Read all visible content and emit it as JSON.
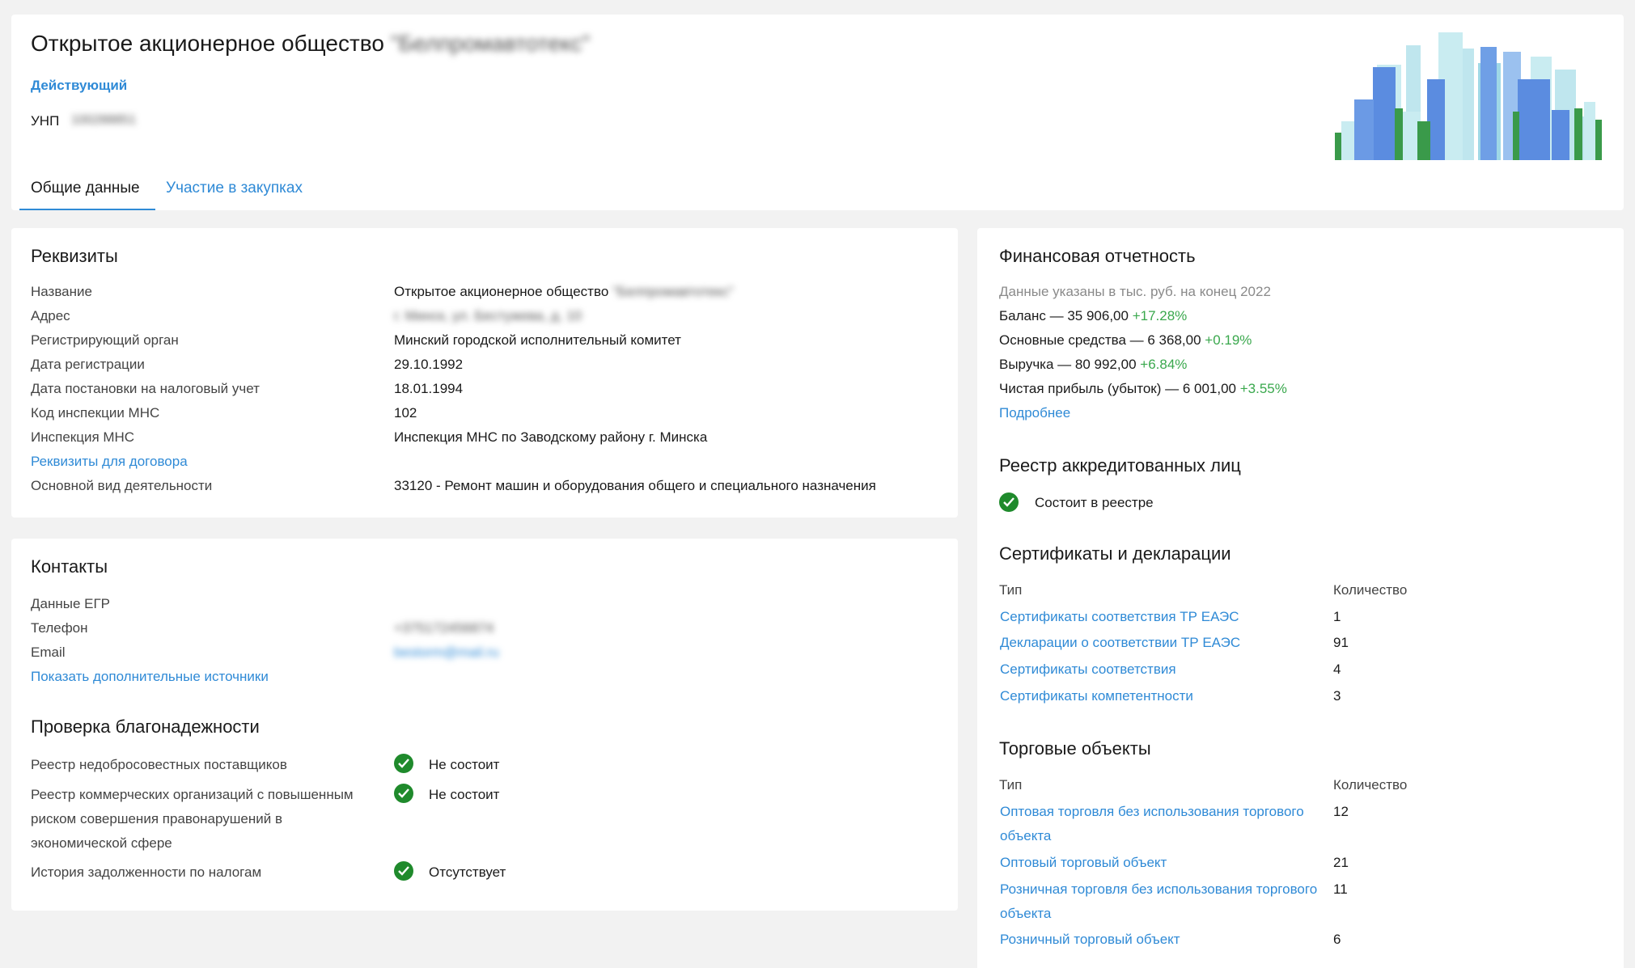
{
  "header": {
    "company_title_prefix": "Открытое акционерное общество",
    "company_title_name": "\"Белпромавтотекс\"",
    "status": "Действующий",
    "unp_label": "УНП",
    "unp_value": "100288851",
    "tabs": [
      {
        "label": "Общие данные",
        "active": true
      },
      {
        "label": "Участие в закупках",
        "active": false
      }
    ]
  },
  "requisites": {
    "title": "Реквизиты",
    "rows": [
      {
        "label": "Название",
        "value": "Открытое акционерное общество",
        "value_blurred": "\"Белпромавтотекс\""
      },
      {
        "label": "Адрес",
        "value": "",
        "value_blurred": "г. Минск, ул. Бестужева, д. 10"
      },
      {
        "label": "Регистрирующий орган",
        "value": "Минский городской исполнительный комитет"
      },
      {
        "label": "Дата регистрации",
        "value": "29.10.1992"
      },
      {
        "label": "Дата постановки на налоговый учет",
        "value": "18.01.1994"
      },
      {
        "label": "Код инспекции МНС",
        "value": "102"
      },
      {
        "label": "Инспекция МНС",
        "value": "Инспекция МНС по Заводскому району г. Минска"
      },
      {
        "label": "Реквизиты для договора",
        "value": ""
      },
      {
        "label": "Основной вид деятельности",
        "value": "33120 - Ремонт машин и оборудования общего и специального назначения"
      }
    ]
  },
  "contacts": {
    "title": "Контакты",
    "egr_label": "Данные ЕГР",
    "phone_label": "Телефон",
    "phone_value": "+375172456874",
    "email_label": "Email",
    "email_value": "bestorm@mail.ru",
    "more_sources": "Показать дополнительные источники"
  },
  "reliability": {
    "title": "Проверка благонадежности",
    "rows": [
      {
        "label_lines": [
          "Реестр недобросовестных поставщиков"
        ],
        "value": "Не состоит"
      },
      {
        "label_lines": [
          "Реестр коммерческих организаций с повышенным",
          "риском совершения правонарушений в",
          "экономической сфере"
        ],
        "value": "Не состоит"
      },
      {
        "label_lines": [
          "История задолженности по налогам"
        ],
        "value": "Отсутствует"
      }
    ]
  },
  "financial": {
    "title": "Финансовая отчетность",
    "note": "Данные указаны в тыс. руб. на конец 2022",
    "items": [
      {
        "label": "Баланс — 35 906,00",
        "delta": "+17.28%"
      },
      {
        "label": "Основные средства — 6 368,00",
        "delta": "+0.19%"
      },
      {
        "label": "Выручка — 80 992,00",
        "delta": "+6.84%"
      },
      {
        "label": "Чистая прибыль (убыток) — 6 001,00",
        "delta": "+3.55%"
      }
    ],
    "more_link": "Подробнее"
  },
  "accredited": {
    "title": "Реестр аккредитованных лиц",
    "status": "Состоит в реестре"
  },
  "certificates": {
    "title": "Сертификаты и декларации",
    "col_type": "Тип",
    "col_count": "Количество",
    "rows": [
      {
        "type": "Сертификаты соответствия ТР ЕАЭС",
        "count": "1"
      },
      {
        "type": "Декларации о соответствии ТР ЕАЭС",
        "count": "91"
      },
      {
        "type": "Сертификаты соответствия",
        "count": "4"
      },
      {
        "type": "Сертификаты компетентности",
        "count": "3"
      }
    ]
  },
  "trade_objects": {
    "title": "Торговые объекты",
    "col_type": "Тип",
    "col_count": "Количество",
    "rows": [
      {
        "type_lines": [
          "Оптовая торговля без использования торгового",
          "объекта"
        ],
        "count": "12"
      },
      {
        "type_lines": [
          "Оптовый торговый объект"
        ],
        "count": "21"
      },
      {
        "type_lines": [
          "Розничная торговля без использования торгового",
          "объекта"
        ],
        "count": "11"
      },
      {
        "type_lines": [
          "Розничный торговый объект"
        ],
        "count": "6"
      }
    ]
  },
  "colors": {
    "link": "#2f8ad6",
    "positive": "#3aa84d",
    "check": "#1f8a2c",
    "background": "#f2f2f2"
  }
}
